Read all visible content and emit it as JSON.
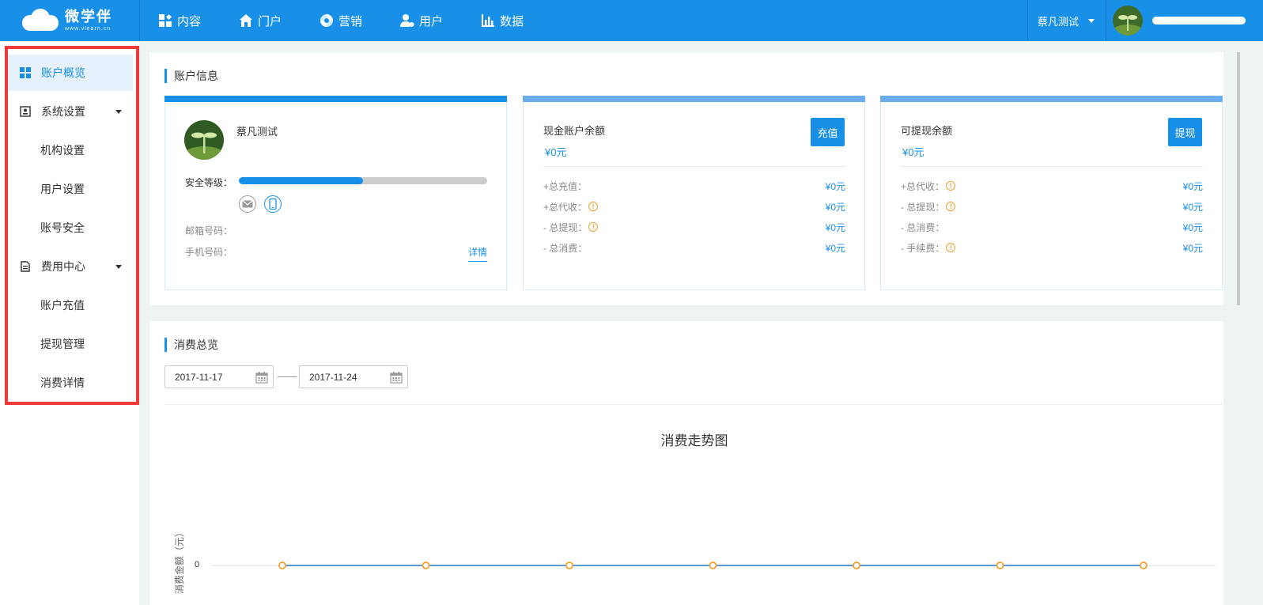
{
  "brand": {
    "name_cn": "微学伴",
    "name_en": "www.vlearn.cn"
  },
  "nav": [
    {
      "label": "内容",
      "icon": "content-grid-icon"
    },
    {
      "label": "门户",
      "icon": "home-icon"
    },
    {
      "label": "营销",
      "icon": "marketing-icon"
    },
    {
      "label": "用户",
      "icon": "user-icon"
    },
    {
      "label": "数据",
      "icon": "bar-chart-icon"
    }
  ],
  "header": {
    "org_name": "蔡凡测试"
  },
  "sidebar": {
    "items": [
      {
        "label": "账户概览"
      },
      {
        "label": "系统设置"
      },
      {
        "label": "机构设置"
      },
      {
        "label": "用户设置"
      },
      {
        "label": "账号安全"
      },
      {
        "label": "费用中心"
      },
      {
        "label": "账户充值"
      },
      {
        "label": "提现管理"
      },
      {
        "label": "消费详情"
      }
    ]
  },
  "account_info": {
    "title": "账户信息",
    "profile": {
      "name": "蔡凡测试",
      "security_label": "安全等级：",
      "security_level": 0.5,
      "email_label": "邮箱号码：",
      "phone_label": "手机号码：",
      "detail_link": "详情"
    },
    "cash": {
      "title": "现金账户余额",
      "value": "¥0元",
      "button": "充值",
      "rows": [
        {
          "label": "+总充值：",
          "value": "¥0元"
        },
        {
          "label": "+总代收：",
          "value": "¥0元"
        },
        {
          "label": "- 总提现：",
          "value": "¥0元"
        },
        {
          "label": "- 总消费：",
          "value": "¥0元"
        }
      ]
    },
    "withdrawable": {
      "title": "可提现余额",
      "value": "¥0元",
      "button": "提现",
      "rows": [
        {
          "label": "+总代收：",
          "value": "¥0元"
        },
        {
          "label": "- 总提现：",
          "value": "¥0元"
        },
        {
          "label": "- 总消费：",
          "value": "¥0元"
        },
        {
          "label": "- 手续费：",
          "value": "¥0元"
        }
      ]
    }
  },
  "consumption": {
    "title": "消费总览",
    "date_from": "2017-11-17",
    "date_to": "2017-11-24"
  },
  "chart_data": {
    "type": "line",
    "title": "消费走势图",
    "ylabel": "消费金额（元）",
    "y_ticks": [
      "0"
    ],
    "series": [
      {
        "values": [
          0,
          0,
          0,
          0,
          0,
          0,
          0
        ]
      }
    ],
    "line_color": "#5b9bd5",
    "marker_color": "#f0a030"
  },
  "colors": {
    "primary": "#1890e8",
    "highlight_border": "#f03a3a",
    "warning": "#f0a030"
  }
}
